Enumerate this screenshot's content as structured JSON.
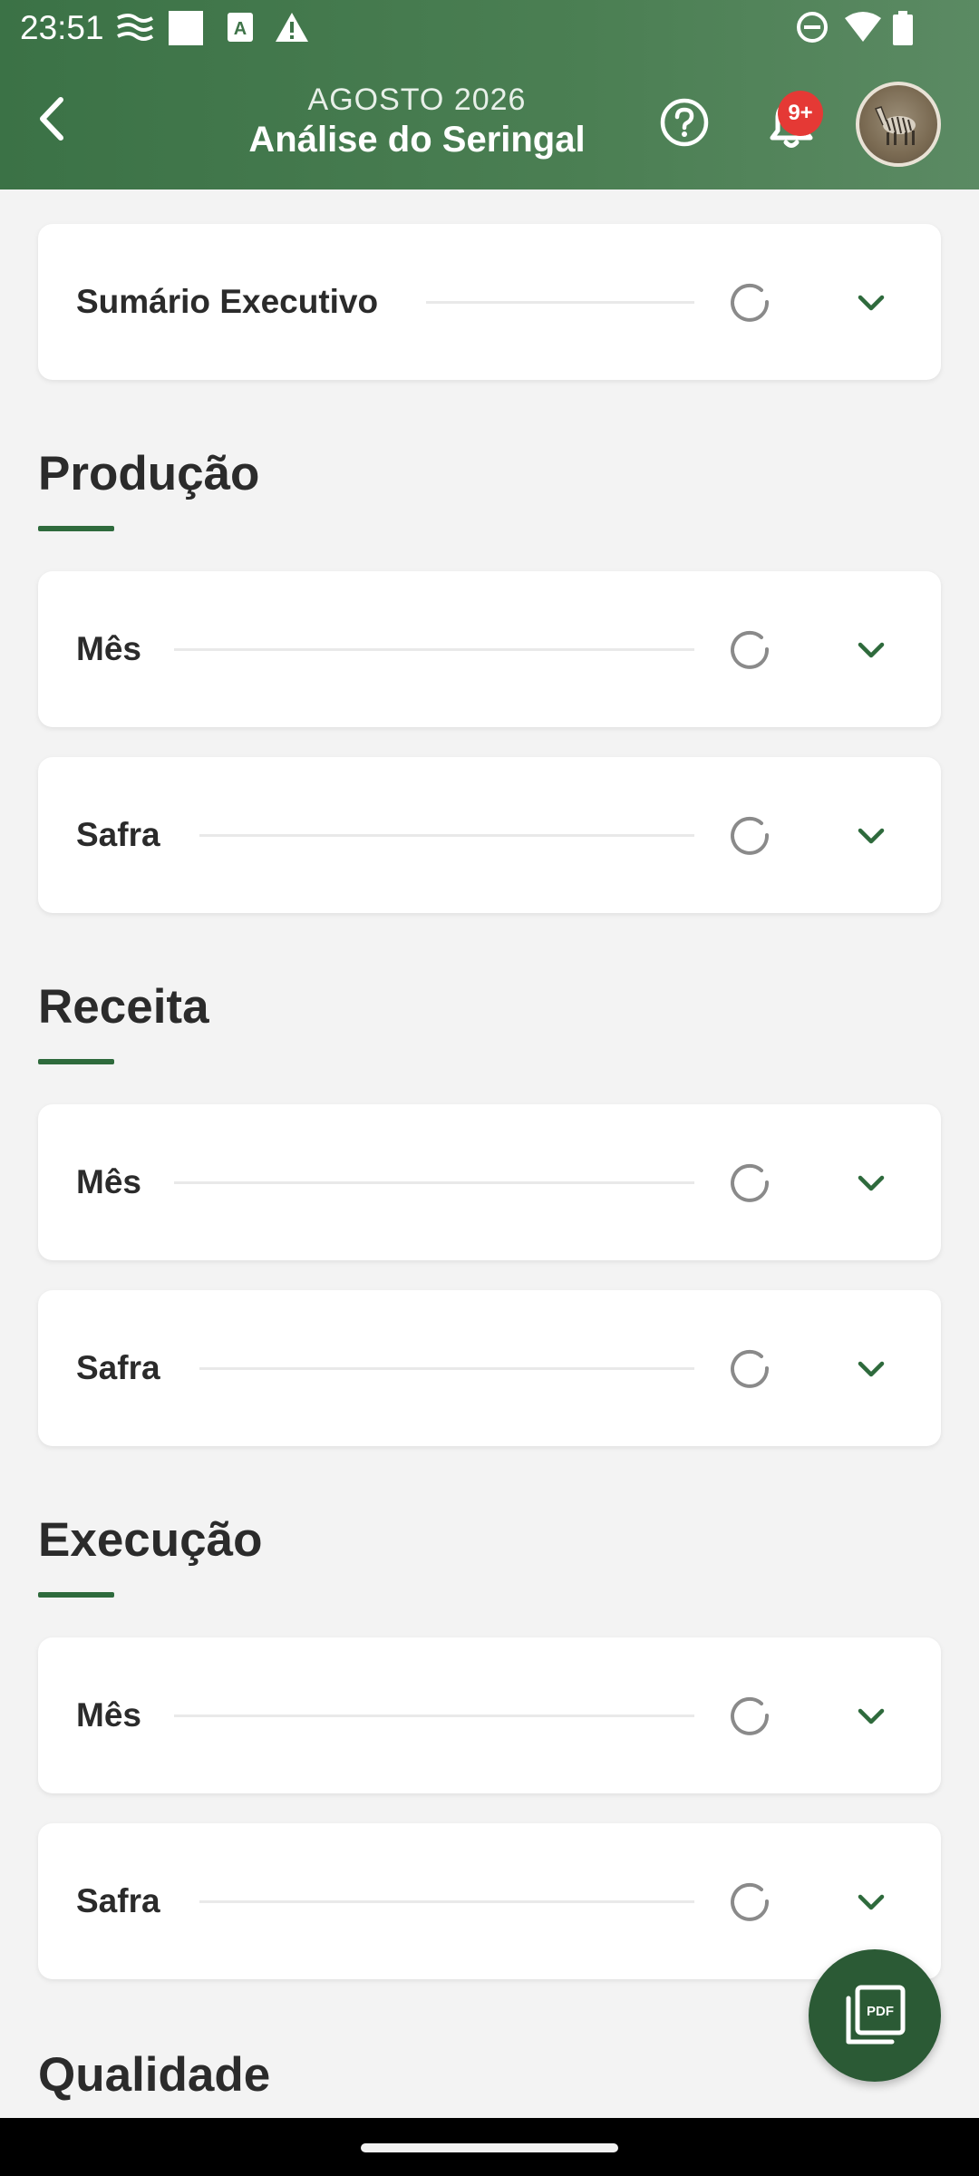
{
  "status_bar": {
    "time": "23:51",
    "left_icons": [
      "wind-icon",
      "blank-square-icon",
      "font-a-icon",
      "warning-icon"
    ],
    "right_icons": [
      "do-not-disturb-icon",
      "wifi-icon",
      "battery-icon"
    ]
  },
  "app_bar": {
    "month": "AGOSTO 2026",
    "title": "Análise do Seringal",
    "notification_badge": "9+",
    "back_icon": "chevron-left-icon",
    "help_icon": "help-circle-icon",
    "bell_icon": "bell-icon"
  },
  "sections": {
    "summary": {
      "label": "Sumário Executivo"
    },
    "producao": {
      "title": "Produção",
      "items": [
        {
          "label": "Mês"
        },
        {
          "label": "Safra"
        }
      ]
    },
    "receita": {
      "title": "Receita",
      "items": [
        {
          "label": "Mês"
        },
        {
          "label": "Safra"
        }
      ]
    },
    "execucao": {
      "title": "Execução",
      "items": [
        {
          "label": "Mês"
        },
        {
          "label": "Safra"
        }
      ]
    },
    "qualidade": {
      "title": "Qualidade"
    }
  },
  "fab": {
    "icon": "pdf-icon"
  },
  "colors": {
    "header_green": "#3b7246",
    "accent_green": "#2e6a3c",
    "fab_green": "#2b5a35",
    "badge_red": "#e53935",
    "background": "#f3f3f3"
  }
}
